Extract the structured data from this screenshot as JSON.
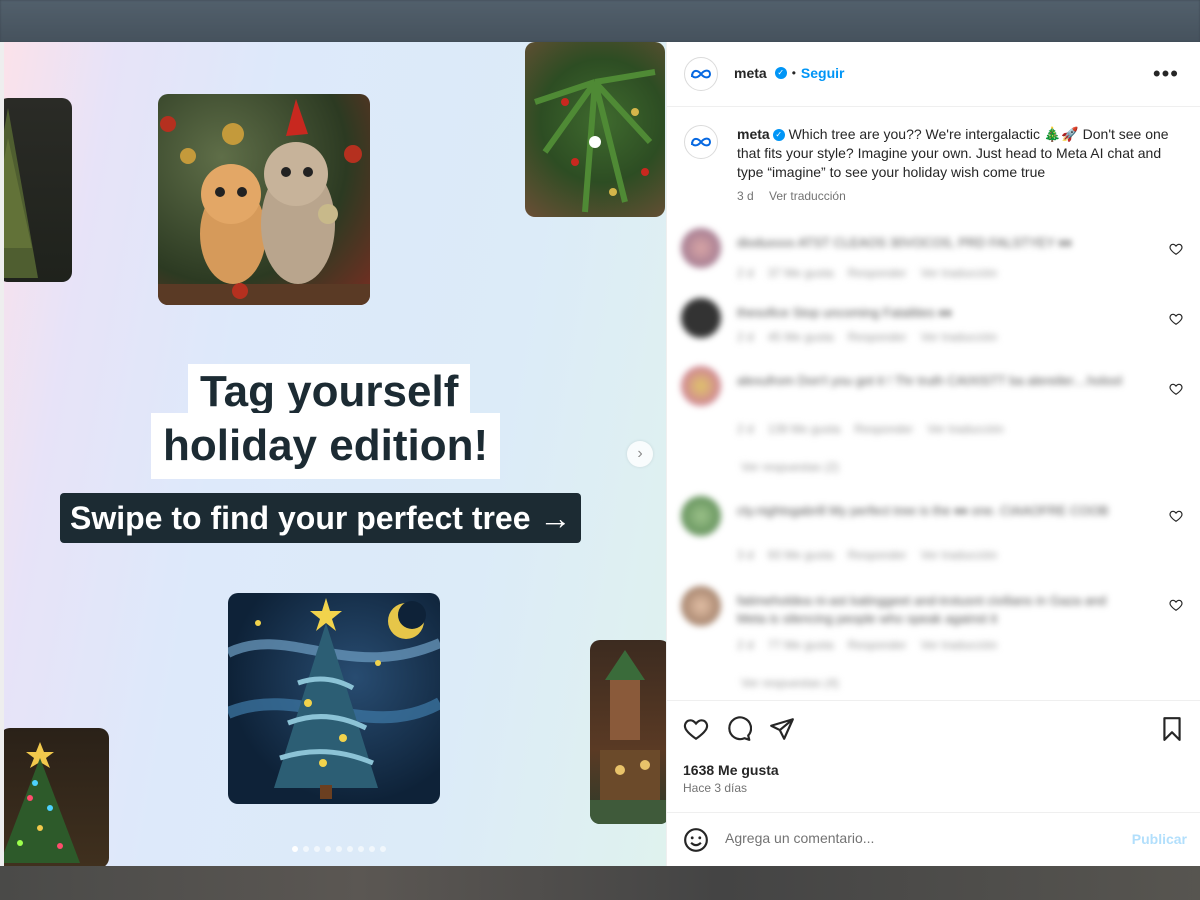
{
  "carousel": {
    "headline_line1": "Tag yourself",
    "headline_line2": "holiday edition!",
    "subtitle": "Swipe to find your perfect tree →",
    "next_icon": "chevron-right-icon",
    "dot_count": 9,
    "active_dot": 0
  },
  "post_header": {
    "username": "meta",
    "separator": "•",
    "follow_label": "Seguir",
    "more_icon": "more-horizontal-icon"
  },
  "caption": {
    "username": "meta",
    "text": "Which tree are you?? We're intergalactic 🎄🚀 Don't see one that fits your style? Imagine your own. Just head to Meta AI chat and type “imagine” to see your holiday wish come true",
    "age": "3 d",
    "translate_label": "Ver traducción"
  },
  "comments": [
    {
      "text": "dioduxxxx ATST CLEAOS 30VOCOS, PRD FALSTYEY ♦♦",
      "age": "2 d",
      "likes": "37 Me gusta",
      "reply": "Responder",
      "translate": "Ver traducción",
      "replies": ""
    },
    {
      "text": "thesofice Stop uncoming Fatalities ♦♦",
      "age": "2 d",
      "likes": "45 Me gusta",
      "reply": "Responder",
      "translate": "Ver traducción",
      "replies": ""
    },
    {
      "text": "alexufrom Don't you got it ! Thr truth CAIXISTT ba alereiler....holool",
      "age": "2 d",
      "likes": "139 Me gusta",
      "reply": "Responder",
      "translate": "Ver traducción",
      "replies": "Ver respuestas (2)"
    },
    {
      "text": "cty.nightsgabrill My perfect tree is the ♦♦ one. CIAAOFRE COOB",
      "age": "3 d",
      "likes": "93 Me gusta",
      "reply": "Responder",
      "translate": "Ver traducción",
      "replies": ""
    },
    {
      "text": "fatimeholdea ni-ast katinggeet and-trotusnt civilians in Gaza and Meta is silencing people who speak against it",
      "age": "2 d",
      "likes": "77 Me gusta",
      "reply": "Responder",
      "translate": "Ver traducción",
      "replies": "Ver respuestas (4)"
    }
  ],
  "actions": {
    "like_icon": "heart-icon",
    "comment_icon": "comment-icon",
    "share_icon": "send-icon",
    "save_icon": "bookmark-icon",
    "likes_text": "1638 Me gusta",
    "posted_text": "Hace 3 días"
  },
  "comment_box": {
    "emoji_icon": "emoji-icon",
    "placeholder": "Agrega un comentario...",
    "publish_label": "Publicar"
  },
  "colors": {
    "accent": "#0095f6",
    "headline_text": "#1c2b33",
    "subtitle_bg": "#1c2b33"
  }
}
